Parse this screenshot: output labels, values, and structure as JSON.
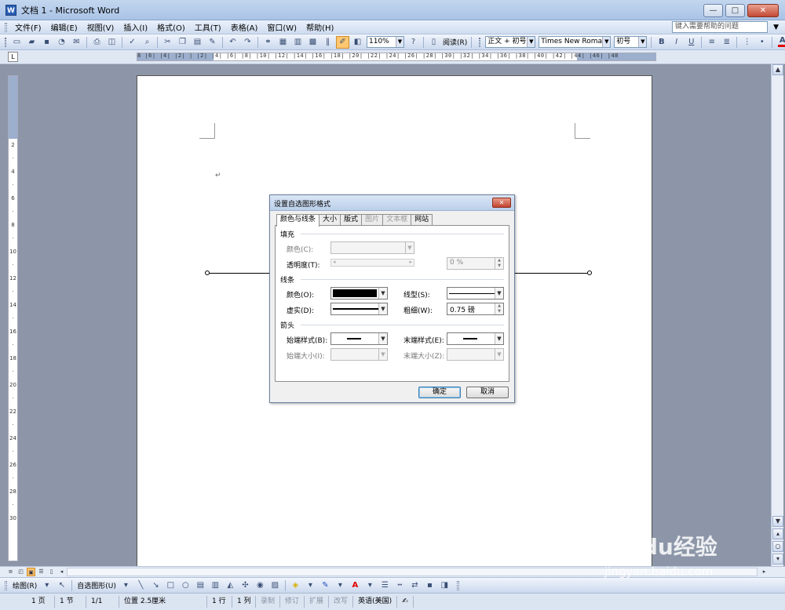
{
  "window": {
    "title": "文档 1 - Microsoft Word",
    "min": "—",
    "max": "□",
    "close": "✕"
  },
  "menu": {
    "items": [
      "文件(F)",
      "编辑(E)",
      "视图(V)",
      "插入(I)",
      "格式(O)",
      "工具(T)",
      "表格(A)",
      "窗口(W)",
      "帮助(H)"
    ],
    "help_placeholder": "键入需要帮助的问题"
  },
  "toolbar": {
    "zoom": "110%",
    "read_label": "阅读(R)",
    "style": "正文 + 初号",
    "font": "Times New Roman",
    "size": "初号",
    "bold": "B",
    "italic": "I",
    "underline": "U",
    "font_color": "A"
  },
  "ruler": {
    "h_ticks": "8 |6| |4| |2| | |2| |4| |6| |8| |10| |12| |14| |16| |18| |20| |22| |24| |26| |28| |30| |32| |34| |36| |38| |40| |42| |44| |46| |48",
    "v_ticks": [
      "2",
      "·",
      "4",
      "·",
      "6",
      "·",
      "8",
      "·",
      "10",
      "·",
      "12",
      "·",
      "14",
      "·",
      "16",
      "·",
      "18",
      "·",
      "20",
      "·",
      "22",
      "·",
      "24",
      "·",
      "26",
      "·",
      "28",
      "·",
      "30"
    ]
  },
  "page": {
    "paragraph_mark": "↵"
  },
  "dialog": {
    "title": "设置自选图形格式",
    "close": "✕",
    "tabs": [
      {
        "label": "颜色与线条",
        "state": "selected"
      },
      {
        "label": "大小",
        "state": "normal"
      },
      {
        "label": "版式",
        "state": "normal"
      },
      {
        "label": "图片",
        "state": "disabled"
      },
      {
        "label": "文本框",
        "state": "disabled"
      },
      {
        "label": "网站",
        "state": "normal"
      }
    ],
    "fill": {
      "section": "填充",
      "color_label": "颜色(C):",
      "transparency_label": "透明度(T):",
      "transparency_value": "0 %"
    },
    "line": {
      "section": "线条",
      "color_label": "颜色(O):",
      "dash_label": "虚实(D):",
      "style_label": "线型(S):",
      "weight_label": "粗细(W):",
      "weight_value": "0.75 磅"
    },
    "arrows": {
      "section": "箭头",
      "begin_style_label": "始端样式(B):",
      "begin_size_label": "始端大小(I):",
      "end_style_label": "末端样式(E):",
      "end_size_label": "末端大小(Z):"
    },
    "ok": "确定",
    "cancel": "取消"
  },
  "drawbar": {
    "draw_label": "绘图(R)",
    "autoshape_label": "自选图形(U)"
  },
  "status": {
    "page": "1 页",
    "section": "1 节",
    "pages": "1/1",
    "position": "位置 2.5厘米",
    "line": "1 行",
    "column": "1 列",
    "rec": "录制",
    "trk": "修订",
    "ext": "扩展",
    "ovr": "改写",
    "lang": "英语(美国)"
  },
  "watermark": {
    "brand": "Baidu经验",
    "url": "jingyan.baidu.com"
  }
}
